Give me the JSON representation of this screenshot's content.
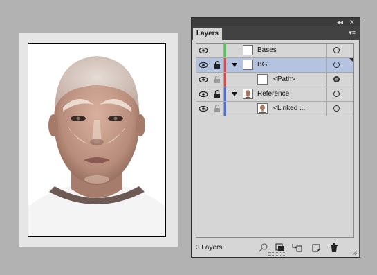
{
  "panel": {
    "tab_label": "Layers",
    "collapse_icon": "double-chevron-left-icon",
    "close_icon": "close-icon",
    "menu_icon": "panel-menu-icon"
  },
  "layers": [
    {
      "name": "Bases",
      "color": "#4fcc4f",
      "level": 0,
      "expandable": false,
      "locked": false,
      "selected": false,
      "thumb": "white"
    },
    {
      "name": "BG",
      "color": "#e04848",
      "level": 0,
      "expandable": true,
      "locked": true,
      "selected": true,
      "thumb": "white"
    },
    {
      "name": "<Path>",
      "color": "#e04848",
      "level": 1,
      "expandable": false,
      "locked": false,
      "selected": false,
      "thumb": "white"
    },
    {
      "name": "Reference",
      "color": "#4a6fe0",
      "level": 0,
      "expandable": true,
      "locked": true,
      "selected": false,
      "thumb": "face"
    },
    {
      "name": "<Linked ...",
      "color": "#4a6fe0",
      "level": 1,
      "expandable": false,
      "locked": false,
      "selected": false,
      "thumb": "face"
    }
  ],
  "footer": {
    "layer_count": "3 Layers",
    "buttons": [
      "locate-object-icon",
      "make-clipping-mask-icon",
      "create-sublayer-icon",
      "new-layer-icon",
      "trash-icon"
    ]
  },
  "colors": {
    "app_background": "#b2b2b2",
    "panel_background": "#d6d6d6",
    "selection": "#b4c4e0"
  }
}
